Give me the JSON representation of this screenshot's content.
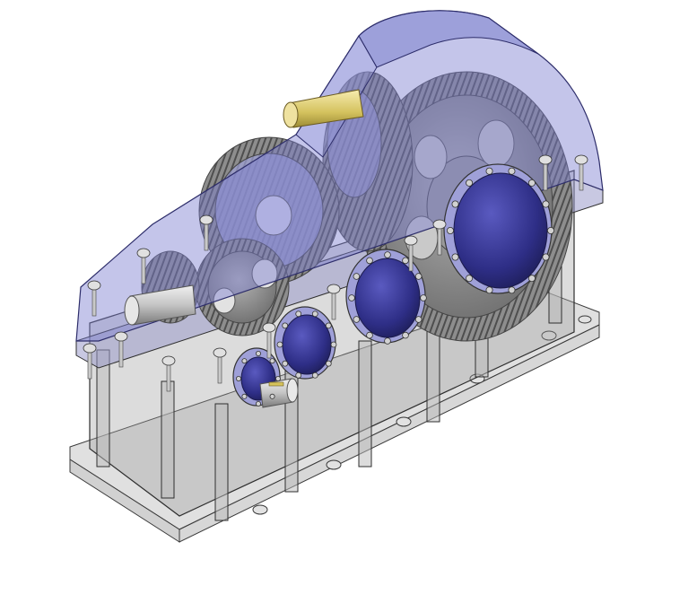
{
  "viewport": {
    "background": "#ffffff"
  },
  "model": {
    "name": "",
    "display_mode": "transparent-shaded",
    "components": [
      "base-plate",
      "lower-housing",
      "upper-cover",
      "large-output-gear",
      "intermediate-gear",
      "small-gear",
      "input-shaft",
      "output-shaft",
      "bearing-cap-large",
      "bearing-cap-medium",
      "bearing-cap-small",
      "bearing-cap-input",
      "bolts"
    ]
  },
  "colors": {
    "cover_blue": "#8c8fd6",
    "cap_blue": "#34348f",
    "gear_gray": "#8a8a8a",
    "housing_gray": "#a0a0a0",
    "shaft": "#c8c8c8",
    "shaft_yellow": "#d8c86a",
    "edge": "#3a3a3a"
  },
  "icons": [
    "bolt-icon",
    "shaft-icon",
    "gear-icon"
  ]
}
